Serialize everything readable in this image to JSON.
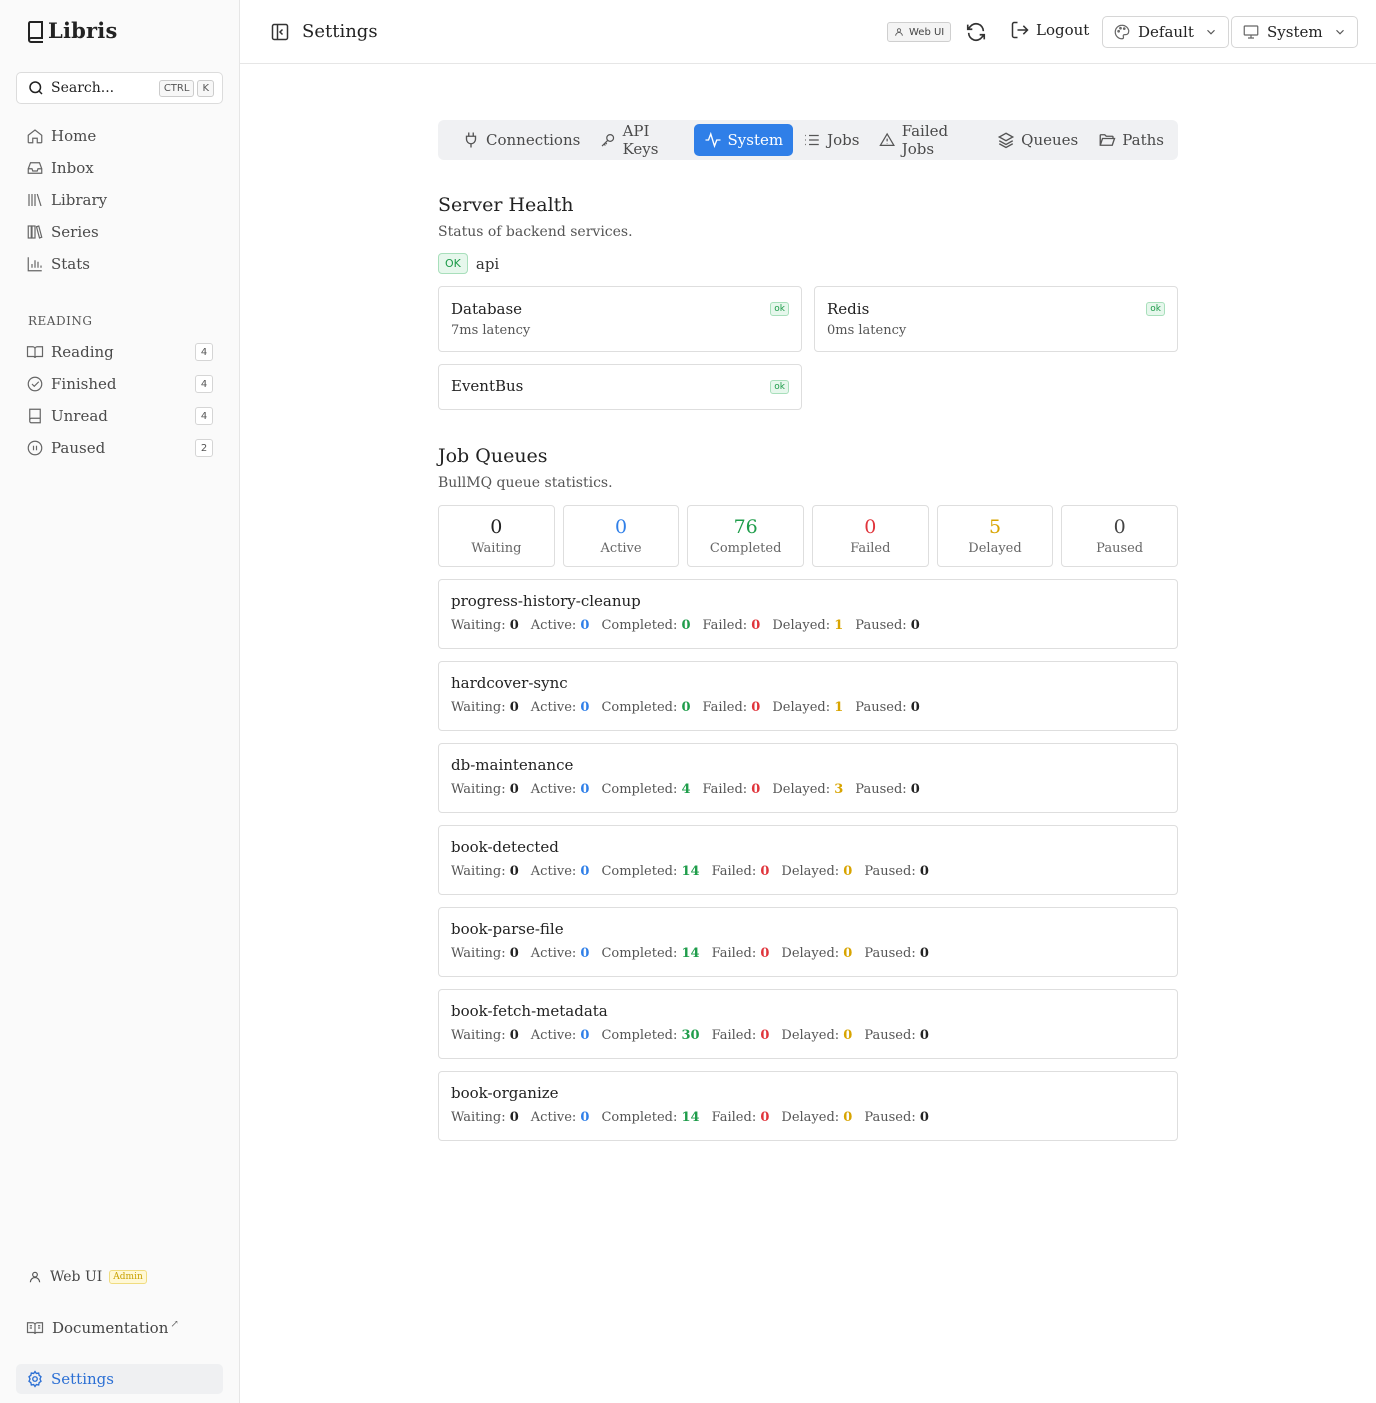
{
  "app": {
    "name": "Libris"
  },
  "search": {
    "placeholder": "Search...",
    "kbd1": "CTRL",
    "kbd2": "K"
  },
  "sidebar": {
    "nav": [
      {
        "label": "Home",
        "icon": "home-icon"
      },
      {
        "label": "Inbox",
        "icon": "inbox-icon"
      },
      {
        "label": "Library",
        "icon": "library-icon"
      },
      {
        "label": "Series",
        "icon": "series-icon"
      },
      {
        "label": "Stats",
        "icon": "stats-icon"
      }
    ],
    "section": "READING",
    "reading": [
      {
        "label": "Reading",
        "count": "4",
        "icon": "book-open-icon"
      },
      {
        "label": "Finished",
        "count": "4",
        "icon": "check-circle-icon"
      },
      {
        "label": "Unread",
        "count": "4",
        "icon": "book-icon"
      },
      {
        "label": "Paused",
        "count": "2",
        "icon": "pause-circle-icon"
      }
    ],
    "user": {
      "label": "Web UI",
      "role": "Admin"
    },
    "docs": {
      "label": "Documentation",
      "ext": "↗"
    },
    "settings": {
      "label": "Settings"
    }
  },
  "topbar": {
    "title": "Settings",
    "chip": "Web UI",
    "logout": "Logout",
    "theme": "Default",
    "mode": "System"
  },
  "tabs": [
    {
      "label": "Connections",
      "icon": "plug-icon",
      "active": false
    },
    {
      "label": "API Keys",
      "icon": "key-icon",
      "active": false
    },
    {
      "label": "System",
      "icon": "activity-icon",
      "active": true
    },
    {
      "label": "Jobs",
      "icon": "list-icon",
      "active": false
    },
    {
      "label": "Failed Jobs",
      "icon": "alert-triangle-icon",
      "active": false
    },
    {
      "label": "Queues",
      "icon": "layers-icon",
      "active": false
    },
    {
      "label": "Paths",
      "icon": "folder-open-icon",
      "active": false
    }
  ],
  "health": {
    "title": "Server Health",
    "subtitle": "Status of backend services.",
    "api_status": "OK",
    "api_label": "api",
    "services": [
      {
        "name": "Database",
        "latency": "7ms latency",
        "status": "ok"
      },
      {
        "name": "Redis",
        "latency": "0ms latency",
        "status": "ok"
      },
      {
        "name": "EventBus",
        "latency": "",
        "status": "ok"
      }
    ]
  },
  "queues": {
    "title": "Job Queues",
    "subtitle": "BullMQ queue statistics.",
    "totals": [
      {
        "value": "0",
        "label": "Waiting",
        "color": "#222222"
      },
      {
        "value": "0",
        "label": "Active",
        "color": "#2f7fe8"
      },
      {
        "value": "76",
        "label": "Completed",
        "color": "#1f9d4b"
      },
      {
        "value": "0",
        "label": "Failed",
        "color": "#e0343b"
      },
      {
        "value": "5",
        "label": "Delayed",
        "color": "#d8a400"
      },
      {
        "value": "0",
        "label": "Paused",
        "color": "#444444"
      }
    ],
    "labels": {
      "waiting": "Waiting:",
      "active": "Active:",
      "completed": "Completed:",
      "failed": "Failed:",
      "delayed": "Delayed:",
      "paused": "Paused:"
    },
    "list": [
      {
        "name": "progress-history-cleanup",
        "waiting": "0",
        "active": "0",
        "completed": "0",
        "failed": "0",
        "delayed": "1",
        "paused": "0"
      },
      {
        "name": "hardcover-sync",
        "waiting": "0",
        "active": "0",
        "completed": "0",
        "failed": "0",
        "delayed": "1",
        "paused": "0"
      },
      {
        "name": "db-maintenance",
        "waiting": "0",
        "active": "0",
        "completed": "4",
        "failed": "0",
        "delayed": "3",
        "paused": "0"
      },
      {
        "name": "book-detected",
        "waiting": "0",
        "active": "0",
        "completed": "14",
        "failed": "0",
        "delayed": "0",
        "paused": "0"
      },
      {
        "name": "book-parse-file",
        "waiting": "0",
        "active": "0",
        "completed": "14",
        "failed": "0",
        "delayed": "0",
        "paused": "0"
      },
      {
        "name": "book-fetch-metadata",
        "waiting": "0",
        "active": "0",
        "completed": "30",
        "failed": "0",
        "delayed": "0",
        "paused": "0"
      },
      {
        "name": "book-organize",
        "waiting": "0",
        "active": "0",
        "completed": "14",
        "failed": "0",
        "delayed": "0",
        "paused": "0"
      }
    ]
  }
}
